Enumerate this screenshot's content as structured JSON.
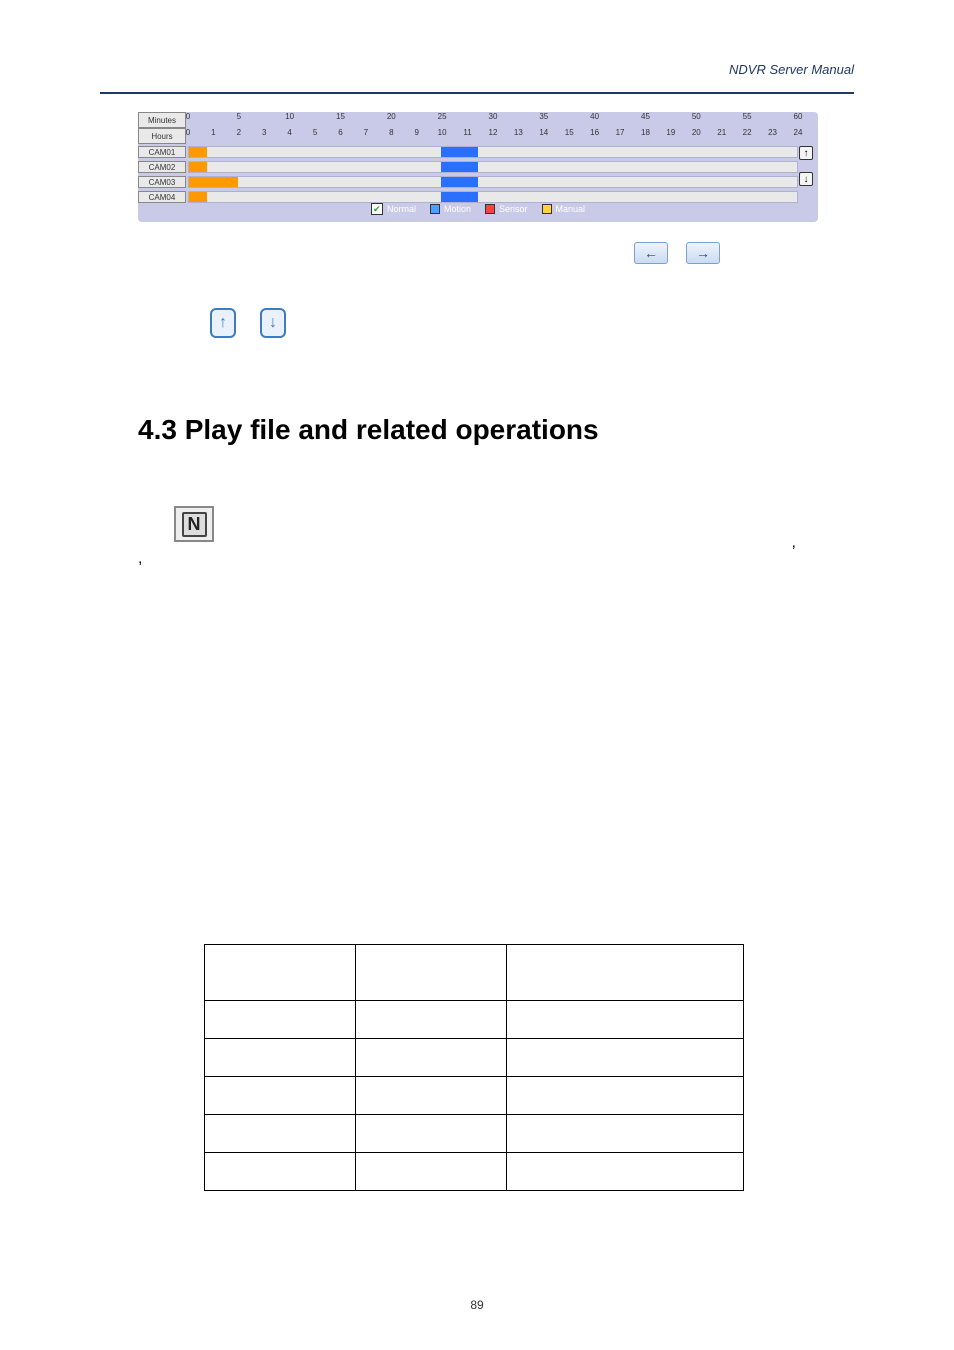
{
  "header": {
    "doc_title": "NDVR Server Manual"
  },
  "timeline": {
    "minutes_label": "Minutes",
    "hours_label": "Hours",
    "minutes_ticks": [
      "0",
      "5",
      "10",
      "15",
      "20",
      "25",
      "30",
      "35",
      "40",
      "45",
      "50",
      "55",
      "60"
    ],
    "hours_ticks": [
      "0",
      "1",
      "2",
      "3",
      "4",
      "5",
      "6",
      "7",
      "8",
      "9",
      "10",
      "11",
      "12",
      "13",
      "14",
      "15",
      "16",
      "17",
      "18",
      "19",
      "20",
      "21",
      "22",
      "23",
      "24"
    ],
    "cameras": [
      "CAM01",
      "CAM02",
      "CAM03",
      "CAM04"
    ],
    "legend": {
      "normal": "Normal",
      "motion": "Motion",
      "sensor": "Sensor",
      "manual": "Manual"
    },
    "arrows": {
      "up": "↑",
      "down": "↓"
    }
  },
  "nav": {
    "prev": "←",
    "next": "→"
  },
  "ud": {
    "up": "↑",
    "down": "↓"
  },
  "heading": "4.3 Play file and related operations",
  "thumb_glyph": "N",
  "punct": {
    "c1": ",",
    "c2": ","
  },
  "table": {
    "head": {
      "c1": "",
      "c2": "",
      "c3": ""
    },
    "rows": [
      {
        "c1": "",
        "c2": "",
        "c3": ""
      },
      {
        "c1": "",
        "c2": "",
        "c3": ""
      },
      {
        "c1": "",
        "c2": "",
        "c3": ""
      },
      {
        "c1": "",
        "c2": "",
        "c3": ""
      },
      {
        "c1": "",
        "c2": "",
        "c3": ""
      }
    ]
  },
  "page_number": "89"
}
